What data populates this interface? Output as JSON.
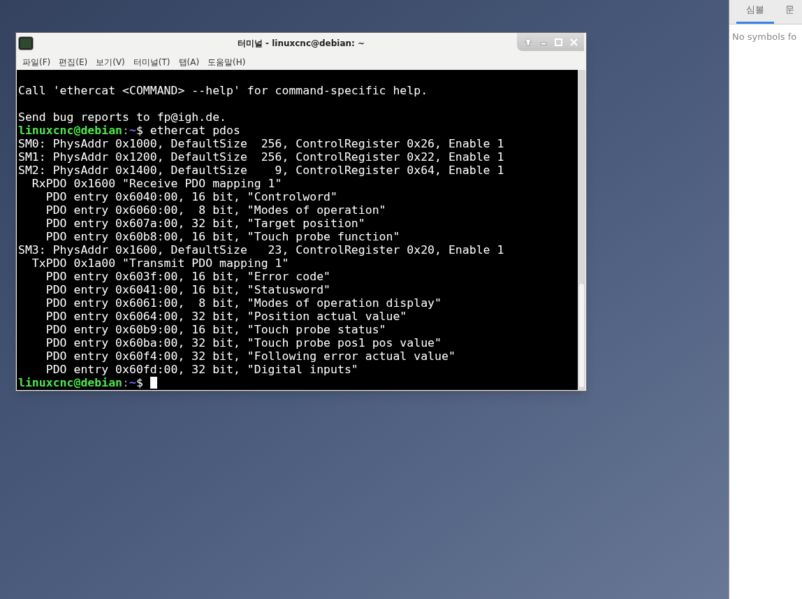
{
  "window": {
    "title": "터미널 - linuxcnc@debian: ~"
  },
  "menu": [
    "파일(F)",
    "편집(E)",
    "보기(V)",
    "터미널(T)",
    "탭(A)",
    "도움말(H)"
  ],
  "terminal_lines": [
    {
      "kind": "blank"
    },
    {
      "kind": "output",
      "text": "Call 'ethercat <COMMAND> --help' for command-specific help."
    },
    {
      "kind": "blank"
    },
    {
      "kind": "output",
      "text": "Send bug reports to fp@igh.de."
    },
    {
      "kind": "prompt",
      "user": "linuxcnc@debian",
      "separator": ":",
      "path": "~",
      "command": "$ ethercat pdos"
    },
    {
      "kind": "output",
      "text": "SM0: PhysAddr 0x1000, DefaultSize  256, ControlRegister 0x26, Enable 1"
    },
    {
      "kind": "output",
      "text": "SM1: PhysAddr 0x1200, DefaultSize  256, ControlRegister 0x22, Enable 1"
    },
    {
      "kind": "output",
      "text": "SM2: PhysAddr 0x1400, DefaultSize    9, ControlRegister 0x64, Enable 1"
    },
    {
      "kind": "output",
      "text": "  RxPDO 0x1600 \"Receive PDO mapping 1\""
    },
    {
      "kind": "output",
      "text": "    PDO entry 0x6040:00, 16 bit, \"Controlword\""
    },
    {
      "kind": "output",
      "text": "    PDO entry 0x6060:00,  8 bit, \"Modes of operation\""
    },
    {
      "kind": "output",
      "text": "    PDO entry 0x607a:00, 32 bit, \"Target position\""
    },
    {
      "kind": "output",
      "text": "    PDO entry 0x60b8:00, 16 bit, \"Touch probe function\""
    },
    {
      "kind": "output",
      "text": "SM3: PhysAddr 0x1600, DefaultSize   23, ControlRegister 0x20, Enable 1"
    },
    {
      "kind": "output",
      "text": "  TxPDO 0x1a00 \"Transmit PDO mapping 1\""
    },
    {
      "kind": "output",
      "text": "    PDO entry 0x603f:00, 16 bit, \"Error code\""
    },
    {
      "kind": "output",
      "text": "    PDO entry 0x6041:00, 16 bit, \"Statusword\""
    },
    {
      "kind": "output",
      "text": "    PDO entry 0x6061:00,  8 bit, \"Modes of operation display\""
    },
    {
      "kind": "output",
      "text": "    PDO entry 0x6064:00, 32 bit, \"Position actual value\""
    },
    {
      "kind": "output",
      "text": "    PDO entry 0x60b9:00, 16 bit, \"Touch probe status\""
    },
    {
      "kind": "output",
      "text": "    PDO entry 0x60ba:00, 32 bit, \"Touch probe pos1 pos value\""
    },
    {
      "kind": "output",
      "text": "    PDO entry 0x60f4:00, 32 bit, \"Following error actual value\""
    },
    {
      "kind": "output",
      "text": "    PDO entry 0x60fd:00, 32 bit, \"Digital inputs\""
    },
    {
      "kind": "prompt",
      "user": "linuxcnc@debian",
      "separator": ":",
      "path": "~",
      "command": "$ ",
      "cursor": true
    }
  ],
  "side_panel": {
    "tabs": [
      {
        "label": "심볼",
        "selected": true
      },
      {
        "label": "문",
        "selected": false
      }
    ],
    "message": "No symbols fo"
  }
}
